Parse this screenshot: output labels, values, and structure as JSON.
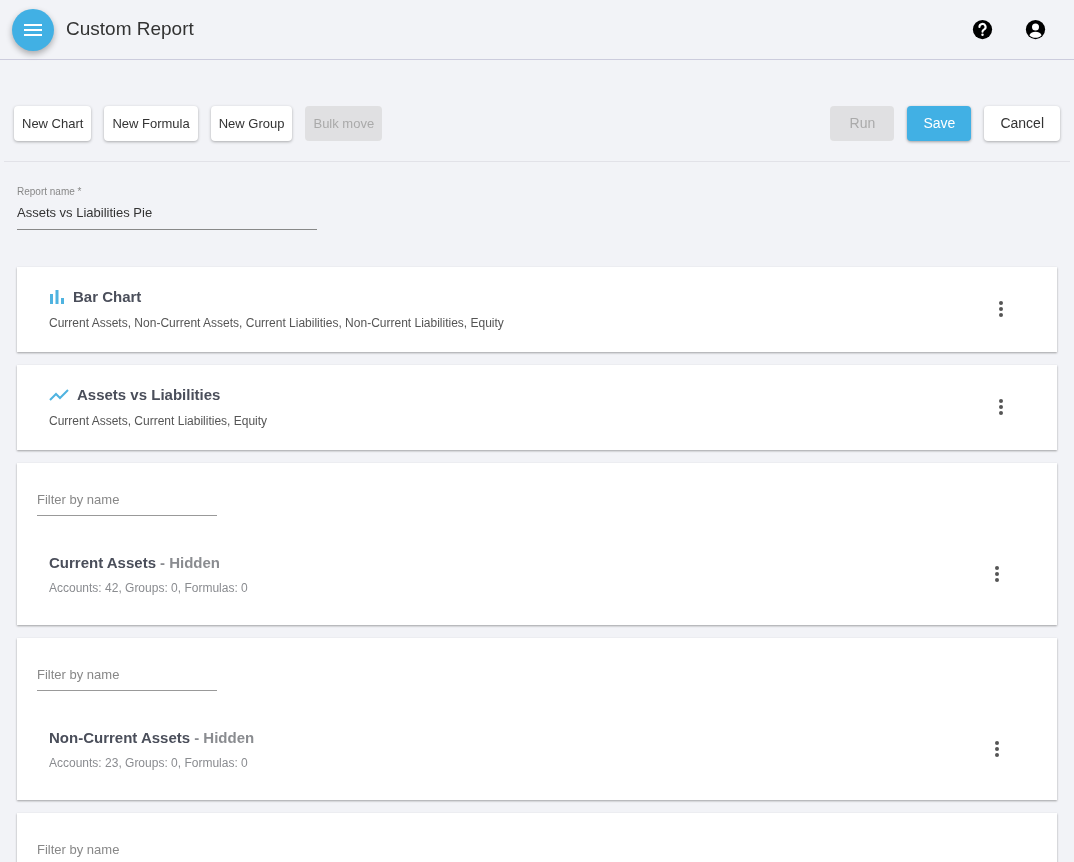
{
  "header": {
    "title": "Custom Report"
  },
  "toolbar": {
    "left": [
      {
        "label": "New Chart",
        "disabled": false
      },
      {
        "label": "New Formula",
        "disabled": false
      },
      {
        "label": "New Group",
        "disabled": false
      },
      {
        "label": "Bulk move",
        "disabled": true
      }
    ],
    "right": [
      {
        "label": "Run",
        "kind": "plain",
        "disabled": true
      },
      {
        "label": "Save",
        "kind": "primary",
        "disabled": false
      },
      {
        "label": "Cancel",
        "kind": "plain",
        "disabled": false
      }
    ]
  },
  "report_name": {
    "label": "Report name *",
    "value": "Assets vs Liabilities Pie"
  },
  "items": [
    {
      "kind": "bar-chart",
      "title": "Bar Chart",
      "subtitle": "Current Assets, Non-Current Assets, Current Liabilities, Non-Current Liabilities, Equity"
    },
    {
      "kind": "line-chart",
      "title": "Assets vs Liabilities",
      "subtitle": "Current Assets, Current Liabilities, Equity"
    },
    {
      "kind": "group",
      "filter_placeholder": "Filter by name",
      "title": "Current Assets",
      "tag": "- Hidden",
      "subtitle": "Accounts: 42, Groups: 0, Formulas: 0"
    },
    {
      "kind": "group",
      "filter_placeholder": "Filter by name",
      "title": "Non-Current Assets",
      "tag": "- Hidden",
      "subtitle": "Accounts: 23, Groups: 0, Formulas: 0"
    },
    {
      "kind": "group",
      "filter_placeholder": "Filter by name"
    }
  ]
}
